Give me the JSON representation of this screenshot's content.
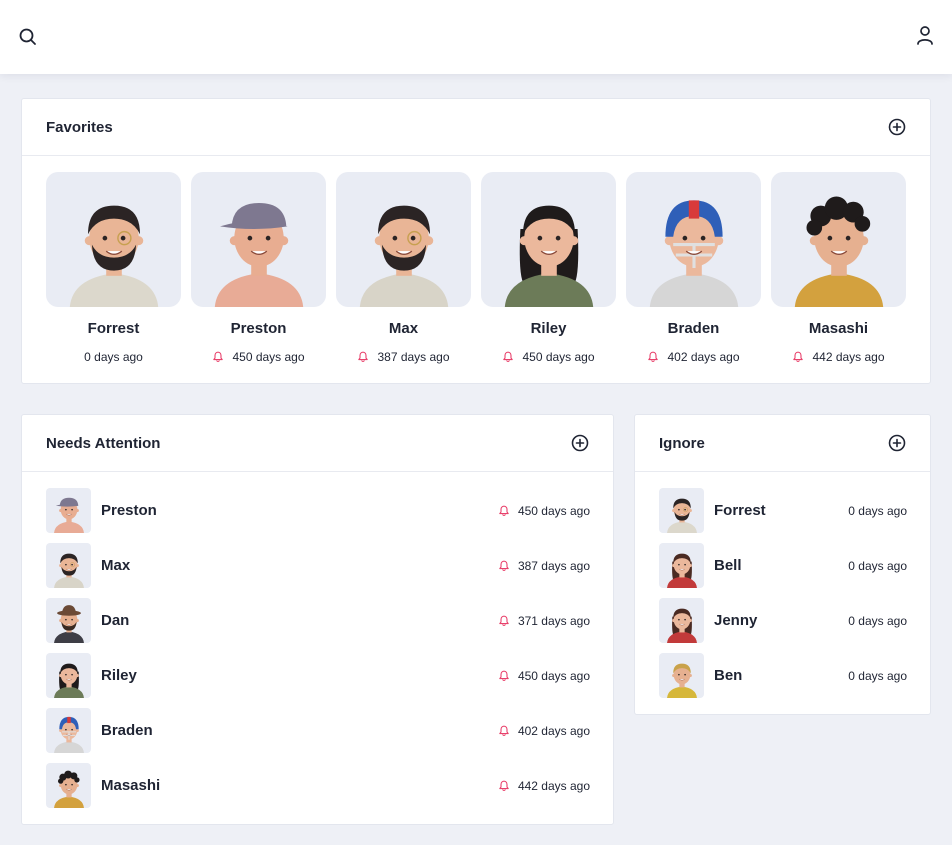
{
  "colors": {
    "background": "#eef0f6",
    "card": "#ffffff",
    "text": "#1f2433",
    "bell": "#e8416b",
    "avatar_bg": "#e9ecf4"
  },
  "header": {
    "left_icon": "search-icon",
    "right_icon": "user-icon"
  },
  "favorites": {
    "title": "Favorites",
    "add_icon": "plus-circle-icon",
    "items": [
      {
        "name": "Forrest",
        "time": "0 days ago",
        "bell": false,
        "avatar": "forrest"
      },
      {
        "name": "Preston",
        "time": "450 days ago",
        "bell": true,
        "avatar": "preston"
      },
      {
        "name": "Max",
        "time": "387 days ago",
        "bell": true,
        "avatar": "max"
      },
      {
        "name": "Riley",
        "time": "450 days ago",
        "bell": true,
        "avatar": "riley"
      },
      {
        "name": "Braden",
        "time": "402 days ago",
        "bell": true,
        "avatar": "braden"
      },
      {
        "name": "Masashi",
        "time": "442 days ago",
        "bell": true,
        "avatar": "masashi"
      }
    ]
  },
  "needs_attention": {
    "title": "Needs Attention",
    "add_icon": "plus-circle-icon",
    "items": [
      {
        "name": "Preston",
        "time": "450 days ago",
        "bell": true,
        "avatar": "preston"
      },
      {
        "name": "Max",
        "time": "387 days ago",
        "bell": true,
        "avatar": "max"
      },
      {
        "name": "Dan",
        "time": "371 days ago",
        "bell": true,
        "avatar": "dan"
      },
      {
        "name": "Riley",
        "time": "450 days ago",
        "bell": true,
        "avatar": "riley"
      },
      {
        "name": "Braden",
        "time": "402 days ago",
        "bell": true,
        "avatar": "braden"
      },
      {
        "name": "Masashi",
        "time": "442 days ago",
        "bell": true,
        "avatar": "masashi"
      }
    ]
  },
  "ignore": {
    "title": "Ignore",
    "add_icon": "plus-circle-icon",
    "items": [
      {
        "name": "Forrest",
        "time": "0 days ago",
        "bell": false,
        "avatar": "forrest"
      },
      {
        "name": "Bell",
        "time": "0 days ago",
        "bell": false,
        "avatar": "bell"
      },
      {
        "name": "Jenny",
        "time": "0 days ago",
        "bell": false,
        "avatar": "jenny"
      },
      {
        "name": "Ben",
        "time": "0 days ago",
        "bell": false,
        "avatar": "ben"
      }
    ]
  }
}
